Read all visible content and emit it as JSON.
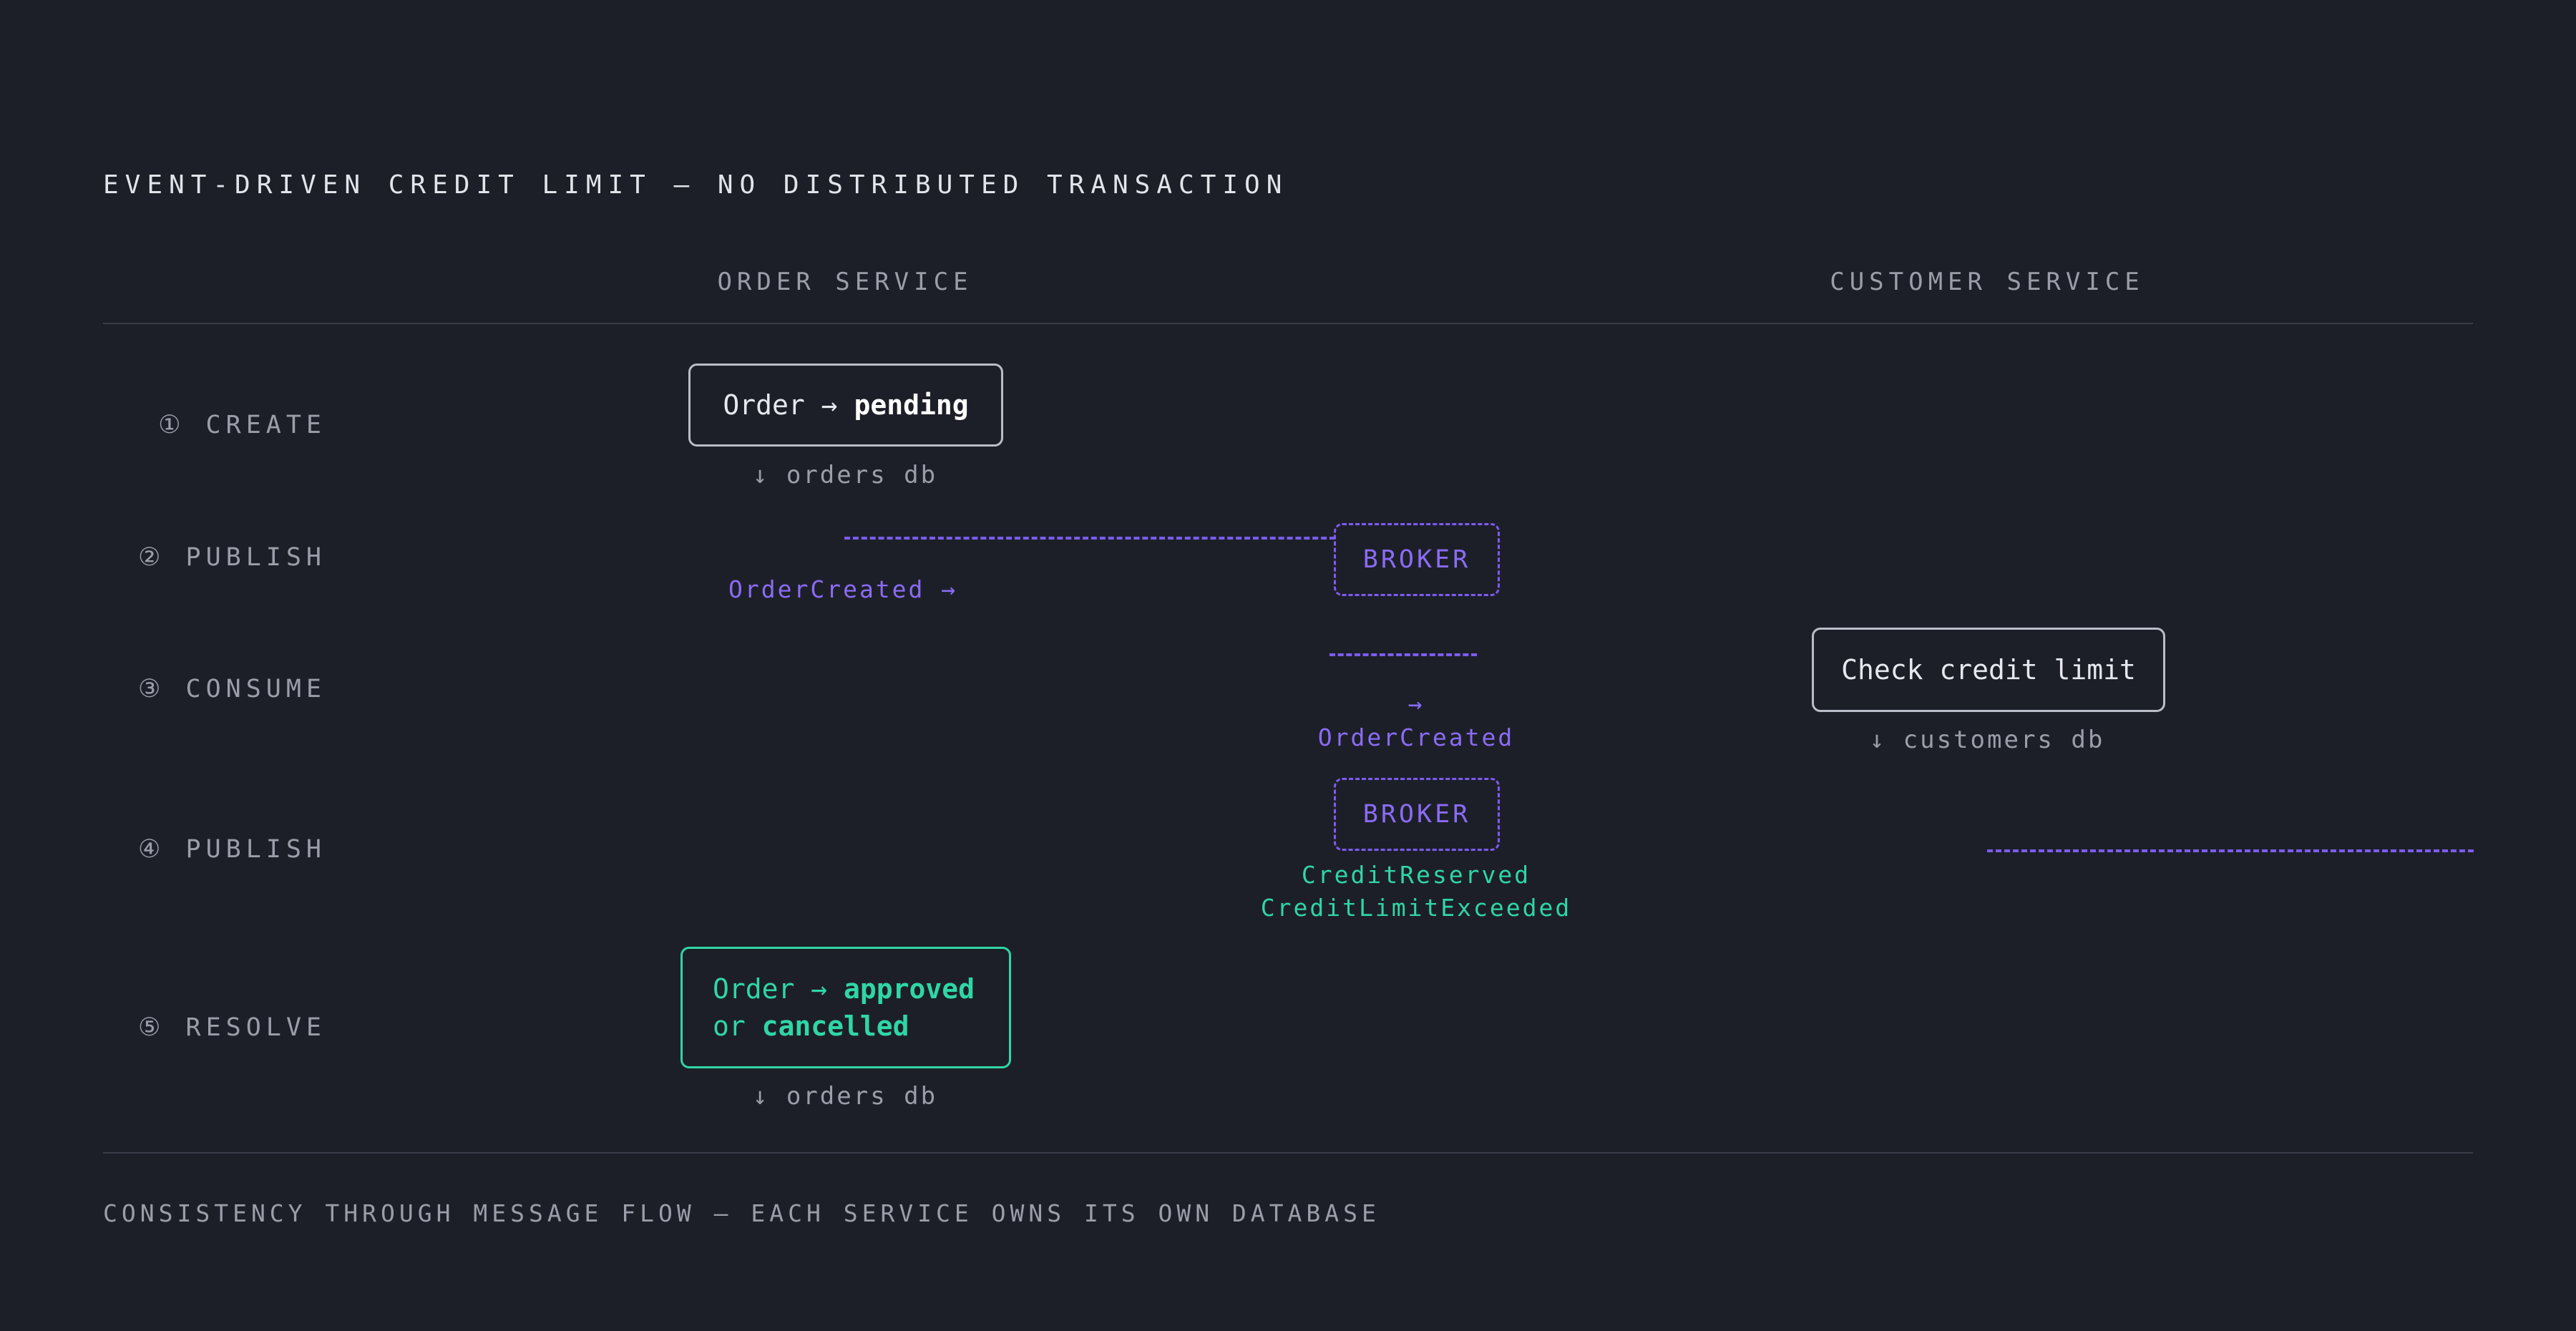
{
  "title": "EVENT-DRIVEN CREDIT LIMIT — NO DISTRIBUTED TRANSACTION",
  "columns": {
    "order": "ORDER SERVICE",
    "customer": "CUSTOMER SERVICE"
  },
  "steps": [
    {
      "label": "① CREATE"
    },
    {
      "label": "② PUBLISH"
    },
    {
      "label": "③ CONSUME"
    },
    {
      "label": "④ PUBLISH"
    },
    {
      "label": "⑤ RESOLVE"
    }
  ],
  "order_box": {
    "prefix": "Order → ",
    "state": "pending"
  },
  "orders_db_1": "↓ orders db",
  "event_order_created_1": "OrderCreated →",
  "broker_1": "BROKER",
  "consume_arrow": "→",
  "event_order_created_2": "OrderCreated",
  "check_box": "Check credit limit",
  "customers_db": "↓ customers db",
  "broker_2": "BROKER",
  "event_credit_reserved": "CreditReserved",
  "event_credit_exceeded": "CreditLimitExceeded",
  "resolve_box": {
    "prefix": "Order → ",
    "approved": "approved",
    "or": "or ",
    "cancelled": "cancelled"
  },
  "orders_db_2": "↓ orders db",
  "footer": "CONSISTENCY THROUGH MESSAGE FLOW — EACH SERVICE OWNS ITS OWN DATABASE",
  "colors": {
    "background": "#1d1f28",
    "event_purple": "#8a6cf5",
    "success_green": "#2fd6a6",
    "muted_text": "#9a9ea9"
  }
}
